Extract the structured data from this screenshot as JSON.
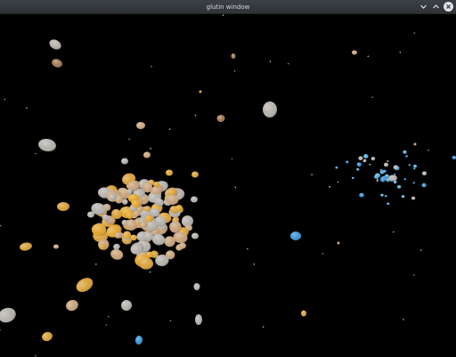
{
  "window": {
    "title": "glutin window",
    "controls": {
      "minimize_icon": "chevron-down-icon",
      "maximize_icon": "chevron-up-icon",
      "close_icon": "close-icon"
    }
  },
  "scene": {
    "background": "#000000",
    "palette": {
      "gray": "#b4b0aa",
      "tan": "#c8a27a",
      "orange": "#d9a03a",
      "gold": "#e0a42c",
      "brown": "#a37a4e",
      "blue": "#3a95d6",
      "lightblue": "#5ab0e0"
    }
  }
}
